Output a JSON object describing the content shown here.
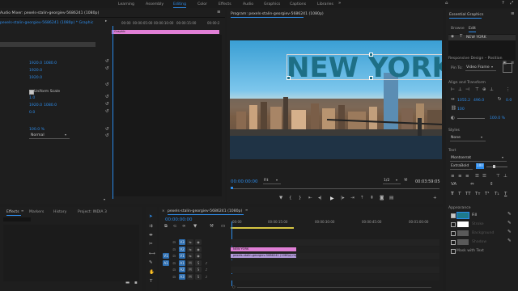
{
  "workspaces": [
    "Learning",
    "Assembly",
    "Editing",
    "Color",
    "Effects",
    "Audio",
    "Graphics",
    "Captions",
    "Libraries"
  ],
  "active_workspace": "Editing",
  "effect_controls": {
    "tab_label": "Audio Mixer: pexels-stalin-georgiev-5686241 (1080p)",
    "subtab": "pexels-stalin-georgiev-5686241 (1080p) * Graphic",
    "clip_badge": "Graphic",
    "timecodes": [
      "00:00",
      "00:00:05:00",
      "00:00:10:00",
      "00:00:15:00",
      "00:00:2"
    ],
    "values": [
      {
        "a": "1920.0",
        "b": "1080.0"
      },
      {
        "a": "1920.0",
        "b": ""
      },
      {
        "a": "1920.0",
        "b": ""
      },
      {
        "a": "1.0",
        "b": ""
      },
      {
        "a": "1920.0",
        "b": "1080.0"
      },
      {
        "a": "0.0",
        "b": ""
      },
      {
        "a": "100.0 %",
        "b": ""
      }
    ],
    "uniform_scale_label": "Uniform Scale",
    "blend_mode": "Normal"
  },
  "program_monitor": {
    "title": "Program: pexels-stalin-georgiev-5686241 (1080p)",
    "overlay_text": "NEW YORK",
    "timecode_current": "00:00:00:00",
    "fit": "Fit",
    "resolution": "1/2",
    "timecode_duration": "00:03:59:05"
  },
  "essential_graphics": {
    "title": "Essential Graphics",
    "tabs": [
      "Browse",
      "Edit"
    ],
    "active_tab": "Edit",
    "layer_name": "NEW YORK",
    "responsive_design_label": "Responsive Design – Position",
    "pin_to_label": "Pin To:",
    "pin_to_value": "Video Frame",
    "align_transform_label": "Align and Transform",
    "transform_values": [
      "1055.2",
      "496.0",
      "100",
      "0.0"
    ],
    "opacity_value": "100.0 %",
    "styles_label": "Styles",
    "styles_value": "None",
    "text_label": "Text",
    "font_value": "Montserrat",
    "weight_value": "ExtraBold",
    "font_size": "100",
    "appearance_label": "Appearance",
    "appearance": [
      {
        "label": "Fill",
        "checked": true,
        "color": "#1e7a8c"
      },
      {
        "label": "Stroke",
        "checked": false,
        "color": "#ffffff"
      },
      {
        "label": "Background",
        "checked": false,
        "color": "#5a5a5a"
      },
      {
        "label": "Shadow",
        "checked": false,
        "color": "#5a5a5a"
      }
    ],
    "mask_label": "Mask with Text"
  },
  "project_panel": {
    "tabs": [
      "Effects",
      "Markers",
      "History",
      "Project: INDIA 3"
    ],
    "active_tab": "Effects"
  },
  "timeline": {
    "title": "pexels-stalin-georgiev-5686241 (1080p)",
    "timecode": "00:00:00:00",
    "ruler": [
      "00:00",
      "00:00:15:00",
      "00:00:30:00",
      "00:00:45:00",
      "00:01:00:00"
    ],
    "tracks": [
      "V3",
      "V2",
      "V1",
      "A1",
      "A2",
      "A3"
    ],
    "clips": [
      {
        "label": "NEW YORK",
        "color": "#e07fd6"
      },
      {
        "label": "pexels-stalin-georgiev-5686241 (1080p).mp4 [V]",
        "color": "#b39adb"
      }
    ]
  },
  "colors": {
    "accent": "#2d8ceb",
    "text_fill": "#1e6f86"
  }
}
